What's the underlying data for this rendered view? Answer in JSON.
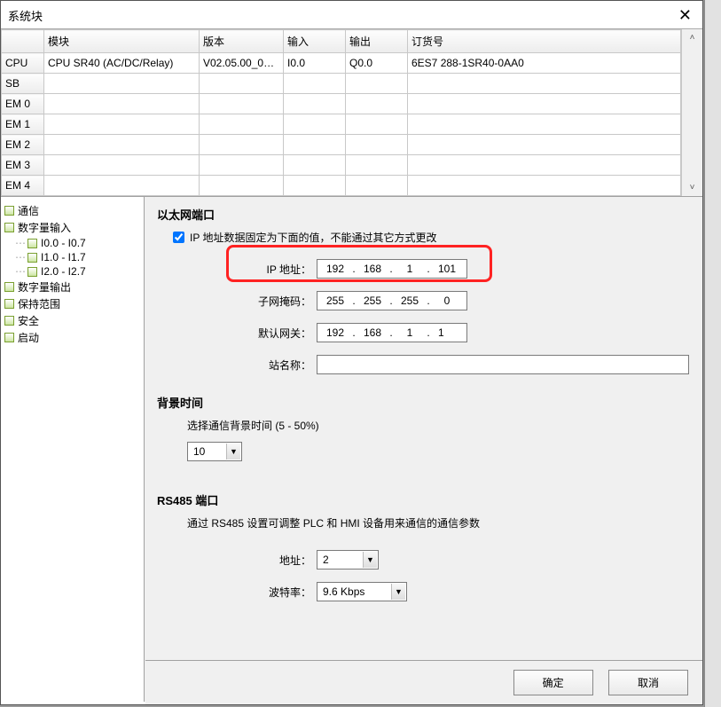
{
  "window": {
    "title": "系统块"
  },
  "grid": {
    "headers": {
      "module": "模块",
      "version": "版本",
      "input": "输入",
      "output": "输出",
      "order": "订货号"
    },
    "rowlabels": [
      "CPU",
      "SB",
      "EM 0",
      "EM 1",
      "EM 2",
      "EM 3",
      "EM 4"
    ],
    "row0": {
      "module": "CPU SR40 (AC/DC/Relay)",
      "version": "V02.05.00_00....",
      "input": "I0.0",
      "output": "Q0.0",
      "order": "6ES7 288-1SR40-0AA0"
    }
  },
  "tree": {
    "comm": "通信",
    "din": "数字量输入",
    "din_children": [
      "I0.0 - I0.7",
      "I1.0 - I1.7",
      "I2.0 - I2.7"
    ],
    "dout": "数字量输出",
    "retain": "保持范围",
    "security": "安全",
    "start": "启动"
  },
  "eth": {
    "title": "以太网端口",
    "fixed_label": "IP 地址数据固定为下面的值，不能通过其它方式更改",
    "ip_label": "IP 地址：",
    "ip": [
      "192",
      "168",
      "1",
      "101"
    ],
    "mask_label": "子网掩码：",
    "mask": [
      "255",
      "255",
      "255",
      "0"
    ],
    "gw_label": "默认网关：",
    "gw": [
      "192",
      "168",
      "1",
      "1"
    ],
    "station_label": "站名称："
  },
  "bg": {
    "title": "背景时间",
    "desc": "选择通信背景时间 (5 - 50%)",
    "value": "10"
  },
  "rs485": {
    "title": "RS485 端口",
    "desc": "通过 RS485 设置可调整 PLC 和 HMI 设备用来通信的通信参数",
    "addr_label": "地址：",
    "addr": "2",
    "baud_label": "波特率：",
    "baud": "9.6 Kbps"
  },
  "buttons": {
    "ok": "确定",
    "cancel": "取消"
  }
}
